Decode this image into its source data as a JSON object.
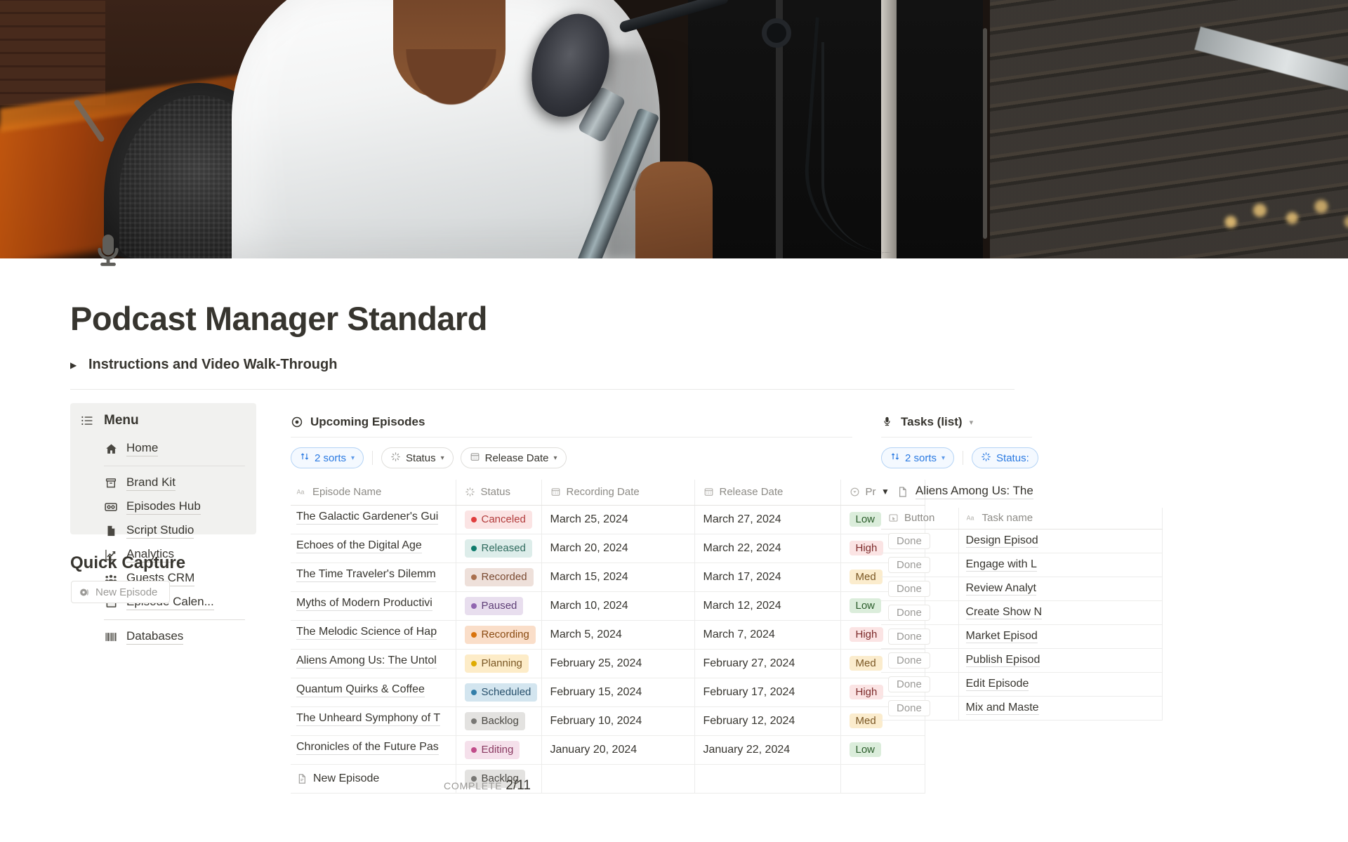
{
  "page": {
    "icon": "microphone-icon",
    "title": "Podcast Manager Standard",
    "toggle_label": "Instructions and Video Walk-Through"
  },
  "sidebar": {
    "menu_label": "Menu",
    "home": {
      "label": "Home",
      "icon": "home-icon"
    },
    "items": [
      {
        "label": "Brand Kit",
        "icon": "archive-box-icon"
      },
      {
        "label": "Episodes Hub",
        "icon": "cassette-tape-icon"
      },
      {
        "label": "Script Studio",
        "icon": "document-icon"
      },
      {
        "label": "Analytics",
        "icon": "chart-line-icon"
      },
      {
        "label": "Guests CRM",
        "icon": "people-group-icon"
      },
      {
        "label": "Episode Calen...",
        "icon": "calendar-icon"
      }
    ],
    "databases": {
      "label": "Databases",
      "icon": "barcode-icon"
    },
    "quick_capture": {
      "heading": "Quick Capture",
      "button_label": "New Episode",
      "button_icon": "record-disc-icon"
    }
  },
  "main_db": {
    "title": "Upcoming Episodes",
    "title_icon": "target-icon",
    "filters": [
      {
        "label": "2 sorts",
        "icon": "sort-arrows-icon",
        "active": true
      },
      {
        "label": "Status",
        "icon": "loading-spinner-icon",
        "active": false
      },
      {
        "label": "Release Date",
        "icon": "calendar-small-icon",
        "active": false
      }
    ],
    "columns": [
      {
        "label": "Episode Name",
        "icon": "text-aa-icon"
      },
      {
        "label": "Status",
        "icon": "loading-spinner-icon"
      },
      {
        "label": "Recording Date",
        "icon": "calendar-small-icon"
      },
      {
        "label": "Release Date",
        "icon": "calendar-small-icon"
      },
      {
        "label": "Pr",
        "icon": "select-circle-icon"
      }
    ],
    "rows": [
      {
        "name": "The Galactic Gardener's Gui",
        "status": "Canceled",
        "status_color": "#e03e3e",
        "status_bg": "#fbe4e4",
        "status_fg": "#b23c3c",
        "recording": "March 25, 2024",
        "release": "March 27, 2024",
        "priority": "Low",
        "prio_bg": "#dbeddb",
        "prio_fg": "#2a5c2a"
      },
      {
        "name": "Echoes of the Digital Age",
        "status": "Released",
        "status_color": "#0f7b6c",
        "status_bg": "#ddedea",
        "status_fg": "#2f6b5e",
        "recording": "March 20, 2024",
        "release": "March 22, 2024",
        "priority": "High",
        "prio_bg": "#fbe4e4",
        "prio_fg": "#7d2b2b"
      },
      {
        "name": "The Time Traveler's Dilemm",
        "status": "Recorded",
        "status_color": "#a9704e",
        "status_bg": "#eee0da",
        "status_fg": "#7a4a31",
        "recording": "March 15, 2024",
        "release": "March 17, 2024",
        "priority": "Med",
        "prio_bg": "#fbeccd",
        "prio_fg": "#7a5724"
      },
      {
        "name": "Myths of Modern Productivi",
        "status": "Paused",
        "status_color": "#9065b0",
        "status_bg": "#e8deee",
        "status_fg": "#5f3f77",
        "recording": "March 10, 2024",
        "release": "March 12, 2024",
        "priority": "Low",
        "prio_bg": "#dbeddb",
        "prio_fg": "#2a5c2a"
      },
      {
        "name": "The Melodic Science of Hap",
        "status": "Recording",
        "status_color": "#d9730d",
        "status_bg": "#fadec9",
        "status_fg": "#8a4b12",
        "recording": "March 5, 2024",
        "release": "March 7, 2024",
        "priority": "High",
        "prio_bg": "#fbe4e4",
        "prio_fg": "#7d2b2b"
      },
      {
        "name": "Aliens Among Us: The Untol",
        "status": "Planning",
        "status_color": "#dfab01",
        "status_bg": "#fdecc8",
        "status_fg": "#7a5724",
        "recording": "February 25, 2024",
        "release": "February 27, 2024",
        "priority": "Med",
        "prio_bg": "#fbeccd",
        "prio_fg": "#7a5724"
      },
      {
        "name": "Quantum Quirks & Coffee",
        "status": "Scheduled",
        "status_color": "#337ea9",
        "status_bg": "#d3e5ef",
        "status_fg": "#28506b",
        "recording": "February 15, 2024",
        "release": "February 17, 2024",
        "priority": "High",
        "prio_bg": "#fbe4e4",
        "prio_fg": "#7d2b2b"
      },
      {
        "name": "The Unheard Symphony of T",
        "status": "Backlog",
        "status_color": "#787774",
        "status_bg": "#e3e2e0",
        "status_fg": "#4a4843",
        "recording": "February 10, 2024",
        "release": "February 12, 2024",
        "priority": "Med",
        "prio_bg": "#fbeccd",
        "prio_fg": "#7a5724"
      },
      {
        "name": "Chronicles of the Future Pas",
        "status": "Editing",
        "status_color": "#c14c8a",
        "status_bg": "#f5e0eb",
        "status_fg": "#8a3a62",
        "recording": "January 20, 2024",
        "release": "January 22, 2024",
        "priority": "Low",
        "prio_bg": "#dbeddb",
        "prio_fg": "#2a5c2a"
      }
    ],
    "new_row": {
      "label": "New Episode",
      "icon": "page-icon",
      "status": "Backlog",
      "status_color": "#787774",
      "status_bg": "#e3e2e0",
      "status_fg": "#4a4843"
    },
    "footer": {
      "label": "COMPLETE",
      "value": "2/11"
    }
  },
  "right_panel": {
    "title": "Tasks (list)",
    "title_icon": "microphone-small-icon",
    "filters": [
      {
        "label": "2 sorts",
        "icon": "sort-arrows-icon",
        "active": true
      },
      {
        "label": "Status:",
        "icon": "loading-spinner-icon",
        "active": true
      }
    ],
    "group_name": "Aliens Among Us: The",
    "group_icon": "page-icon",
    "columns": [
      {
        "label": "Button",
        "icon": "button-click-icon"
      },
      {
        "label": "Task name",
        "icon": "text-aa-icon"
      }
    ],
    "rows": [
      {
        "button": "Done",
        "task": "Design Episod"
      },
      {
        "button": "Done",
        "task": "Engage with L"
      },
      {
        "button": "Done",
        "task": "Review Analyt"
      },
      {
        "button": "Done",
        "task": "Create Show N"
      },
      {
        "button": "Done",
        "task": "Market Episod"
      },
      {
        "button": "Done",
        "task": "Publish Episod"
      },
      {
        "button": "Done",
        "task": "Edit Episode"
      },
      {
        "button": "Done",
        "task": "Mix and Maste"
      }
    ]
  }
}
